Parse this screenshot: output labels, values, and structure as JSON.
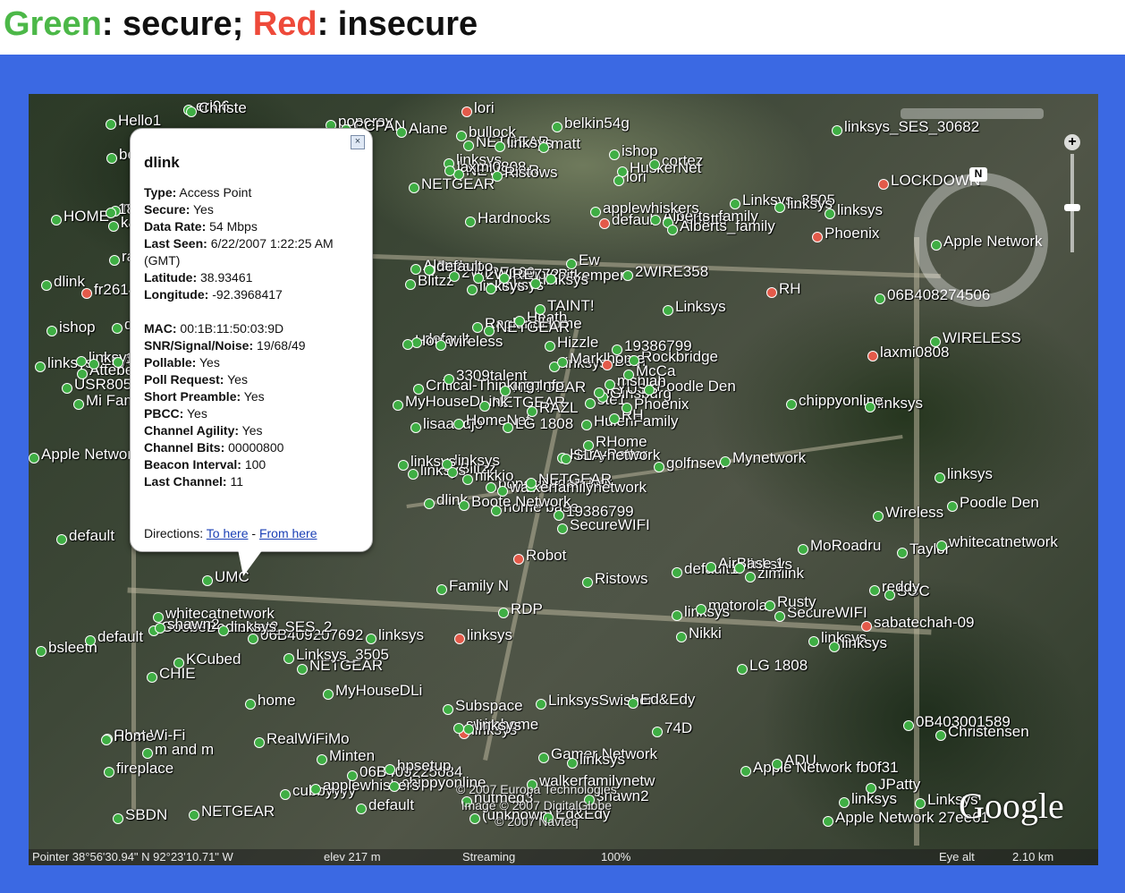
{
  "heading": {
    "secure_word": "Green",
    "secure_text": ": secure; ",
    "insecure_word": "Red",
    "insecure_text": ": insecure",
    "secure_color": "#4cb848",
    "insecure_color": "#ee4a3a"
  },
  "popup": {
    "title": "dlink",
    "fields": [
      {
        "k": "Type:",
        "v": "Access Point"
      },
      {
        "k": "Secure:",
        "v": "Yes"
      },
      {
        "k": "Data Rate:",
        "v": "54 Mbps"
      },
      {
        "k": "Last Seen:",
        "v": "6/22/2007 1:22:25 AM (GMT)"
      },
      {
        "k": "Latitude:",
        "v": "38.93461"
      },
      {
        "k": "Longitude:",
        "v": "-92.3968417"
      },
      {
        "k": "",
        "v": ""
      },
      {
        "k": "MAC:",
        "v": "00:1B:11:50:03:9D"
      },
      {
        "k": "SNR/Signal/Noise:",
        "v": "19/68/49"
      },
      {
        "k": "Pollable:",
        "v": "Yes"
      },
      {
        "k": "Poll Request:",
        "v": "Yes"
      },
      {
        "k": "Short Preamble:",
        "v": "Yes"
      },
      {
        "k": "PBCC:",
        "v": "Yes"
      },
      {
        "k": "Channel Agility:",
        "v": "Yes"
      },
      {
        "k": "Channel Bits:",
        "v": "00000800"
      },
      {
        "k": "Beacon Interval:",
        "v": "100"
      },
      {
        "k": "Last Channel:",
        "v": "11"
      }
    ],
    "directions_label": "Directions:",
    "to_here": "To here",
    "dash": " - ",
    "from_here": "From here"
  },
  "map_labels": [
    "home base",
    "Blitzz",
    "Blitzz",
    "Phat Wi-Fi",
    "ste1",
    "NETGEAR",
    "cortez",
    "SimpleBo",
    "Abbotts",
    "HarryPotter",
    "NETGEAR",
    "Linksys",
    "lisaandjo",
    "Apple Network",
    "dlink",
    "Linksys",
    "NETGEAR",
    "2WIRE160",
    "Hizzle",
    "KCubed",
    "Rockbridge",
    "fireplace",
    "RealWiFiMo",
    "2WIRE772",
    "Ginsburg",
    "zimlink",
    "Bellaroo",
    "NETGEAR",
    "Mi Familia",
    "default1",
    "WIRELESS",
    "linksys",
    "Subspace",
    "HomeNet",
    "eitkemper",
    "Linksys_3505",
    "Linksys_3505",
    "linksys",
    "0B403001589",
    "linksys",
    "belkin54g",
    "Beth",
    "NETGEAR",
    "Nikki",
    "cubbyyyy",
    "linksys",
    "HulenFamily",
    "SBDN",
    "linksys",
    "RHome",
    "CHIE",
    "06B408274506",
    "HOME",
    "motorola",
    "74D",
    "home",
    "bullock",
    "Hello1",
    "LinksysSwisher",
    "linksys",
    "linksys",
    "SLA-network",
    "Enyard",
    "Heath",
    "linksys",
    "eri06",
    "HuskerNet",
    "NETGEAR",
    "NETGEAR",
    "bsleeth",
    "linksys",
    "06B409225684",
    "AirBase 1",
    "linksys",
    "Home",
    "belkin54g",
    "RaglandHome",
    "default",
    "3309talent",
    "Gamer Network",
    "RAZL",
    "m and m",
    "golfnsew",
    "SGC",
    "nutmeg3",
    "linksys",
    "RDP",
    "ADU",
    "Ed&Edy",
    "Ed&Edy",
    "linksys",
    "Poodle Den",
    "Poodle Den",
    "LG 1808",
    "LG 1808",
    "sabatechah-09",
    "AtteberyHome",
    "(unknown)",
    "Alberts_family",
    "Alberts_family",
    "poperay",
    "poperay",
    "linksys",
    "USR8054",
    "UMC",
    "06B409207692",
    "Minten",
    "KYUSS",
    "Phoenix",
    "Phoenix",
    "Wireless",
    "kathy",
    "linksys",
    "linksys",
    "CCPAN",
    "default",
    "Boote Network",
    "LOCKDOWN",
    "Alane",
    "Alane",
    "GoobeBooteNet2",
    "linksys_SES_30682",
    "TAINT!",
    "2WIRE358",
    "Mynetwork",
    "Robot",
    "JPatty",
    "chippyonline",
    "chippyonline",
    "random",
    "shawn2",
    "shawn2",
    "Marklhome",
    "default",
    "Taylor",
    "SecureWIFI",
    "SecureWIFI",
    "whitecatnetwork",
    "whitecatnetwork",
    "19386799",
    "19386799",
    "Critical-Thinking.Info",
    "linksys",
    "Dugan-Net",
    "mshjah",
    "mshjah",
    "hpsetup",
    "Apple Network fb0f31",
    "swimhome",
    "laxmi0808",
    "laxmi0808",
    "linksys",
    "linksys",
    "default",
    "MoRoadru",
    "matt",
    "Hardnocks",
    "NETGEAR",
    "NETGEAR",
    "Ew",
    "Ristows",
    "Ristows",
    "Apple Network",
    "lori",
    "lori",
    "default",
    "Family N",
    "Christensen",
    "Christe",
    "Apple Network 27ee61",
    "linksys",
    "linksys",
    "ishop",
    "ishop",
    "McCa",
    "applewhiskers",
    "applewhiskers",
    "linksys",
    "dlink",
    "default",
    "fr2614",
    "walkerfamilynetwork",
    "walkerfamilynetw",
    "1809",
    "1809",
    "wireless",
    "Hou",
    "MyHouseDLink",
    "MyHouseDLi",
    "nikkio",
    "reddy",
    "linksys",
    "linksys",
    "RH",
    "RH",
    "linksys",
    "linksys",
    "default",
    "Rusty",
    "linksys_SES_2"
  ],
  "copyright": {
    "line1": "© 2007 Europa Technologies",
    "line2": "Image © 2007 DigitalGlobe",
    "line3": "© 2007 Navteq"
  },
  "brand": {
    "name": "Google"
  },
  "nav": {
    "north": "N"
  },
  "statusbar": {
    "pointer": "Pointer 38°56'30.94\" N  92°23'10.71\" W",
    "elev": "elev  217 m",
    "streaming": "Streaming",
    "streaming_pct": "100%",
    "eye_alt": "Eye alt",
    "eye_alt_value": "2.10 km"
  },
  "colors": {
    "secure_dot": "#3fae44",
    "insecure_dot": "#e35a4a",
    "frame": "#3b69e3"
  }
}
